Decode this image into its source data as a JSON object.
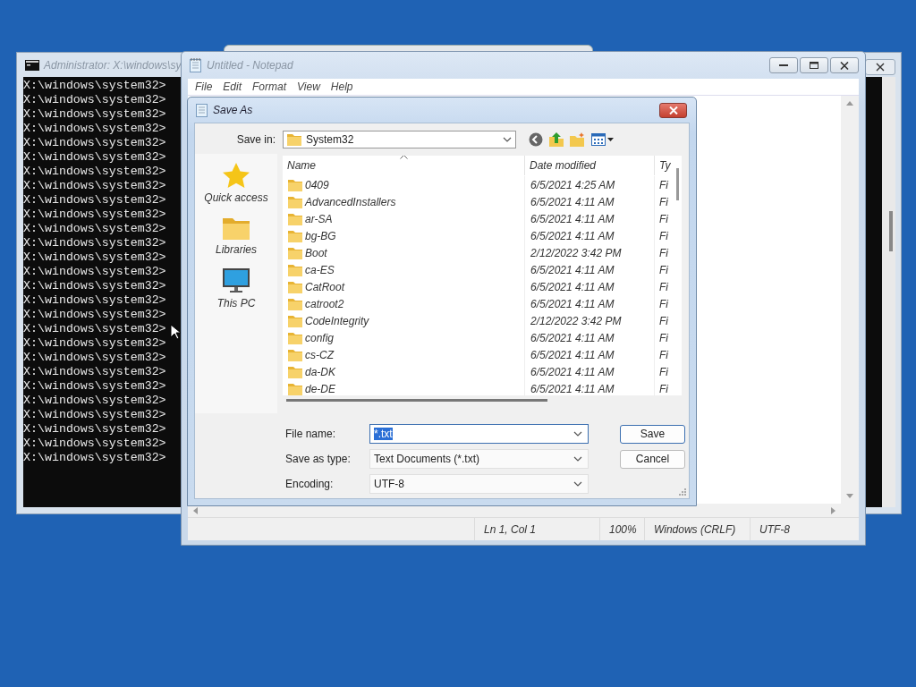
{
  "console_window": {
    "title": "Administrator: X:\\windows\\sy",
    "lines": [
      "X:\\windows\\system32>",
      "X:\\windows\\system32>",
      "X:\\windows\\system32>",
      "X:\\windows\\system32>",
      "X:\\windows\\system32>",
      "X:\\windows\\system32>",
      "X:\\windows\\system32>",
      "X:\\windows\\system32>",
      "X:\\windows\\system32>",
      "X:\\windows\\system32>",
      "X:\\windows\\system32>",
      "X:\\windows\\system32>",
      "X:\\windows\\system32>",
      "X:\\windows\\system32>",
      "X:\\windows\\system32>",
      "X:\\windows\\system32>",
      "X:\\windows\\system32>",
      "X:\\windows\\system32>",
      "X:\\windows\\system32>",
      "X:\\windows\\system32>",
      "X:\\windows\\system32>",
      "X:\\windows\\system32>",
      "X:\\windows\\system32>",
      "X:\\windows\\system32>",
      "X:\\windows\\system32>",
      "X:\\windows\\system32>",
      "X:\\windows\\system32>"
    ]
  },
  "notepad_window": {
    "title": "Untitled - Notepad",
    "menu": [
      "File",
      "Edit",
      "Format",
      "View",
      "Help"
    ],
    "status_bar": [
      "Ln 1, Col 1",
      "100%",
      "Windows (CRLF)",
      "UTF-8"
    ]
  },
  "save_as_dialog": {
    "title": "Save As",
    "save_in": {
      "label": "Save in:",
      "value": "System32"
    },
    "places": [
      {
        "label": "Quick access",
        "kind": "star"
      },
      {
        "label": "Libraries",
        "kind": "folder"
      },
      {
        "label": "This PC",
        "kind": "monitor"
      }
    ],
    "columns": [
      {
        "label": "Name",
        "sorted": true
      },
      {
        "label": "Date modified",
        "sorted": false
      },
      {
        "label": "Ty",
        "sorted": false
      }
    ],
    "rows": [
      {
        "name": "0409",
        "date_modified": "6/5/2021 4:25 AM",
        "column_3": "Fi"
      },
      {
        "name": "AdvancedInstallers",
        "date_modified": "6/5/2021 4:11 AM",
        "column_3": "Fi"
      },
      {
        "name": "ar-SA",
        "date_modified": "6/5/2021 4:11 AM",
        "column_3": "Fi"
      },
      {
        "name": "bg-BG",
        "date_modified": "6/5/2021 4:11 AM",
        "column_3": "Fi"
      },
      {
        "name": "Boot",
        "date_modified": "2/12/2022 3:42 PM",
        "column_3": "Fi"
      },
      {
        "name": "ca-ES",
        "date_modified": "6/5/2021 4:11 AM",
        "column_3": "Fi"
      },
      {
        "name": "CatRoot",
        "date_modified": "6/5/2021 4:11 AM",
        "column_3": "Fi"
      },
      {
        "name": "catroot2",
        "date_modified": "6/5/2021 4:11 AM",
        "column_3": "Fi"
      },
      {
        "name": "CodeIntegrity",
        "date_modified": "2/12/2022 3:42 PM",
        "column_3": "Fi"
      },
      {
        "name": "config",
        "date_modified": "6/5/2021 4:11 AM",
        "column_3": "Fi"
      },
      {
        "name": "cs-CZ",
        "date_modified": "6/5/2021 4:11 AM",
        "column_3": "Fi"
      },
      {
        "name": "da-DK",
        "date_modified": "6/5/2021 4:11 AM",
        "column_3": "Fi"
      },
      {
        "name": "de-DE",
        "date_modified": "6/5/2021 4:11 AM",
        "column_3": "Fi"
      }
    ],
    "fields": [
      {
        "label": "File name:",
        "value": "*.txt",
        "highlighted": true
      },
      {
        "label": "Save as type:",
        "value": "Text Documents (*.txt)",
        "highlighted": false
      },
      {
        "label": "Encoding:",
        "value": "UTF-8",
        "highlighted": false
      }
    ],
    "buttons": [
      "Save",
      "Cancel"
    ]
  }
}
